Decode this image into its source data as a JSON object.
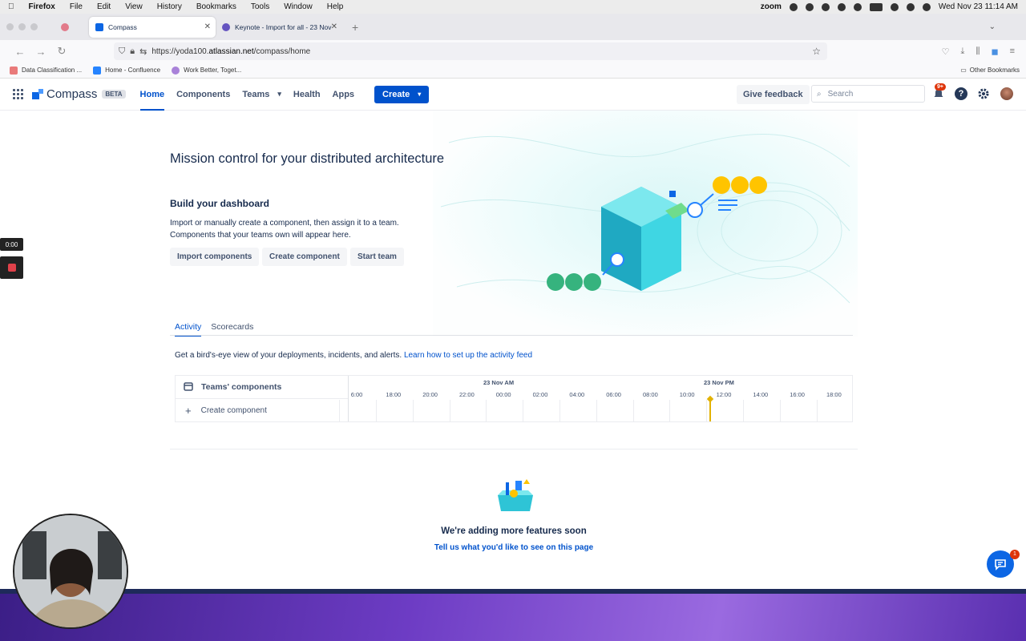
{
  "menubar": {
    "app": "Firefox",
    "items": [
      "File",
      "Edit",
      "View",
      "History",
      "Bookmarks",
      "Tools",
      "Window",
      "Help"
    ],
    "zoom": "zoom",
    "clock": "Wed Nov 23  11:14 AM"
  },
  "browser": {
    "tabs": [
      {
        "label": "Compass",
        "active": true
      },
      {
        "label": "Keynote - Import for all - 23 Nov",
        "active": false
      }
    ],
    "url_prefix": "https://yoda100.",
    "url_host": "atlassian.net",
    "url_path": "/compass/home",
    "bookmarks": [
      "Data Classification ...",
      "Home - Confluence",
      "Work Better, Toget..."
    ],
    "other_bookmarks": "Other Bookmarks"
  },
  "header": {
    "logo_text": "Compass",
    "beta": "BETA",
    "nav": [
      "Home",
      "Components",
      "Teams",
      "Health",
      "Apps"
    ],
    "create": "Create",
    "feedback": "Give feedback",
    "search_placeholder": "Search",
    "notif_badge": "9+"
  },
  "hero": {
    "title": "Mission control for your distributed architecture",
    "subtitle": "Build your dashboard",
    "body": "Import or manually create a component, then assign it to a team. Components that your teams own will appear here.",
    "buttons": [
      "Import components",
      "Create component",
      "Start team"
    ]
  },
  "tabs": [
    "Activity",
    "Scorecards"
  ],
  "activity": {
    "text": "Get a bird's-eye view of your deployments, incidents, and alerts. ",
    "link": "Learn how to set up the activity feed"
  },
  "timeline": {
    "row_title": "Teams' components",
    "create_label": "Create component",
    "dates": [
      "23 Nov AM",
      "23 Nov PM"
    ],
    "hours": [
      "6:00",
      "18:00",
      "20:00",
      "22:00",
      "00:00",
      "02:00",
      "04:00",
      "06:00",
      "08:00",
      "10:00",
      "12:00",
      "14:00",
      "16:00",
      "18:00"
    ]
  },
  "coming_soon": {
    "title": "We're adding more features soon",
    "link": "Tell us what you'd like to see on this page"
  },
  "recording": {
    "time": "0:00"
  },
  "chat_badge": "1",
  "colors": {
    "primary": "#0052cc",
    "text": "#172b4d",
    "accent_yellow": "#e2b203"
  }
}
